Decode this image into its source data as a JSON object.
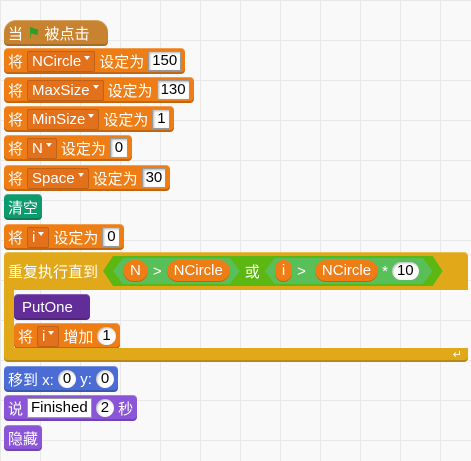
{
  "hat": {
    "when": "当",
    "clicked": "被点击"
  },
  "set_blocks": [
    {
      "prefix": "将",
      "var": "NCircle",
      "to": "设定为",
      "value": "150"
    },
    {
      "prefix": "将",
      "var": "MaxSize",
      "to": "设定为",
      "value": "130"
    },
    {
      "prefix": "将",
      "var": "MinSize",
      "to": "设定为",
      "value": "1"
    },
    {
      "prefix": "将",
      "var": "N",
      "to": "设定为",
      "value": "0"
    },
    {
      "prefix": "将",
      "var": "Space",
      "to": "设定为",
      "value": "30"
    }
  ],
  "clear": {
    "label": "清空"
  },
  "set_i": {
    "prefix": "将",
    "var": "i",
    "to": "设定为",
    "value": "0"
  },
  "repeat_until": {
    "label": "重复执行直到",
    "cond1": {
      "left": "N",
      "op": ">",
      "right": "NCircle"
    },
    "or": "或",
    "cond2": {
      "left": "i",
      "op": ">",
      "right": "NCircle",
      "mul": "*",
      "factor": "10"
    },
    "body": {
      "putone": "PutOne",
      "change": {
        "prefix": "将",
        "var": "i",
        "action": "增加",
        "value": "1"
      }
    }
  },
  "goto": {
    "label": "移到 x:",
    "x": "0",
    "ylabel": "y:",
    "y": "0"
  },
  "say": {
    "label": "说",
    "text": "Finished",
    "secs": "2",
    "unit": "秒"
  },
  "hide": {
    "label": "隐藏"
  },
  "icons": {
    "flag": "green-flag-icon",
    "loop": "loop-arrow-icon"
  }
}
